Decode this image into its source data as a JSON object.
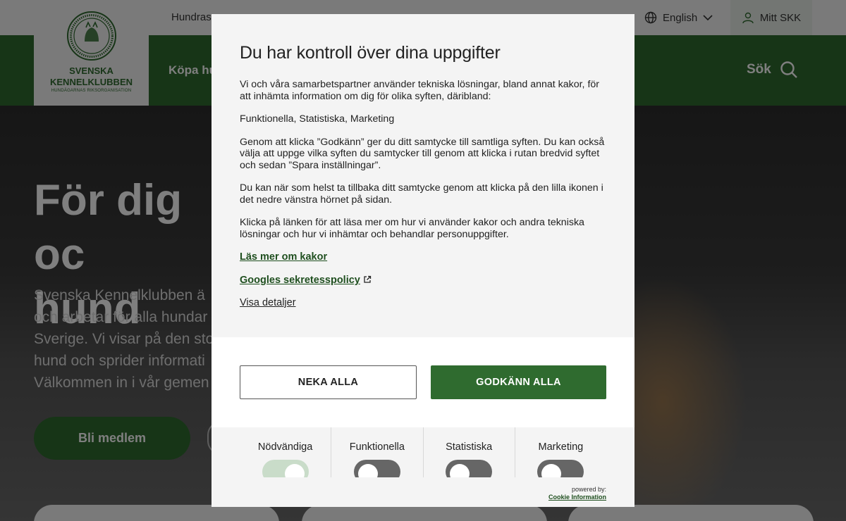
{
  "topbar": {
    "hundras": "Hundras",
    "language": "English",
    "mitt_skk": "Mitt SKK"
  },
  "logo": {
    "line1": "SVENSKA",
    "line2": "KENNELKLUBBEN",
    "subtitle": "HUNDÄGARNAS RIKSORGANISATION"
  },
  "nav": {
    "kopa": "Köpa hu",
    "search": "Sök"
  },
  "hero": {
    "title_line1": "För dig oc",
    "title_line2": "hund",
    "lead": [
      "Svenska Kennelklubben ä",
      "och arbetar för alla hundar",
      "Sverige. Vi visar på den sto",
      "hund och sprider informati",
      "Välkommen in i vår gemen"
    ],
    "cta": "Bli medlem"
  },
  "modal": {
    "title": "Du har kontroll över dina uppgifter",
    "paragraphs": [
      "Vi och våra samarbetspartner använder tekniska lösningar, bland annat kakor, för att inhämta information om dig för olika syften, däribland:",
      "Funktionella, Statistiska, Marketing",
      "Genom att klicka ”Godkänn” ger du ditt samtycke till samtliga syften. Du kan också välja att uppge vilka syften du samtycker till genom att klicka i rutan bredvid syftet och sedan ”Spara inställningar”.",
      "Du kan när som helst ta tillbaka ditt samtycke genom att klicka på den lilla ikonen i det nedre vänstra hörnet på sidan.",
      "Klicka på länken för att läsa mer om hur vi använder kakor och andra tekniska lösningar och hur vi inhämtar och behandlar personuppgifter."
    ],
    "link_cookies": "Läs mer om kakor",
    "link_google": "Googles sekretesspolicy",
    "link_details": "Visa detaljer",
    "deny_all": "NEKA ALLA",
    "accept_all": "GODKÄNN ALLA",
    "toggles": [
      {
        "label": "Nödvändiga",
        "on": true
      },
      {
        "label": "Funktionella",
        "on": false
      },
      {
        "label": "Statistiska",
        "on": false
      },
      {
        "label": "Marketing",
        "on": false
      }
    ],
    "powered_by": "powered by:",
    "provider": "Cookie Information"
  },
  "colors": {
    "brand_green": "#2f6b2f",
    "toggle_off": "#666666",
    "toggle_on": "#c9dcc9"
  }
}
